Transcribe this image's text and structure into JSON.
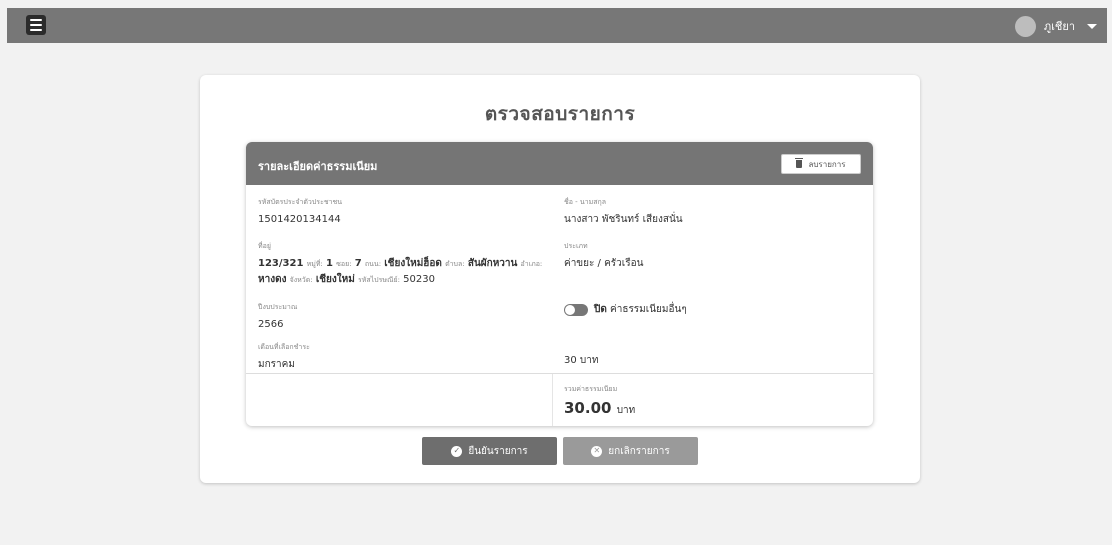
{
  "topbar": {
    "menu_icon": "hamburger-menu-icon",
    "user_name": "ภูเชียา"
  },
  "page": {
    "title": "ตรวจสอบรายการ"
  },
  "panel": {
    "title": "รายละเอียดค่าธรรมเนียม",
    "clear_label": "ลบรายการ",
    "id_label": "รหัสบัตรประจำตัวประชาชน",
    "id_value": "1501420134144",
    "name_label": "ชื่อ - นามสกุล",
    "name_value": "นางสาว พัชรินทร์ เสียงสนั่น",
    "address_label": "ที่อยู่",
    "address": {
      "house": "123/321",
      "moo_label": "หมู่ที่:",
      "moo": "1",
      "soi_label": "ซอย:",
      "soi": "7",
      "road_label": "ถนน:",
      "road": "เชียงใหม่ฮ็อด",
      "subdistrict_label": "ตำบล:",
      "subdistrict": "สันผักหวาน",
      "district_label": "อำเภอ:",
      "district": "หางดง",
      "province_label": "จังหวัด:",
      "province": "เชียงใหม่",
      "postal_label": "รหัสไปรษณีย์:",
      "postal": "50230"
    },
    "type_label": "ประเภท",
    "type_value": "ค่าขยะ / ครัวเรือน",
    "budget_year_label": "ปีงบประมาณ",
    "budget_year_value": "2566",
    "toggle_state": "ปิด",
    "toggle_text": "ค่าธรรมเนียมอื่นๆ",
    "month_label": "เดือนที่เลือกชำระ",
    "month_value": "มกราคม",
    "month_fee": "30 บาท",
    "total_label": "รวมค่าธรรมเนียม",
    "total_amount": "30.00",
    "total_unit": "บาท"
  },
  "actions": {
    "confirm_label": "ยืนยันรายการ",
    "cancel_label": "ยกเลิกรายการ"
  }
}
